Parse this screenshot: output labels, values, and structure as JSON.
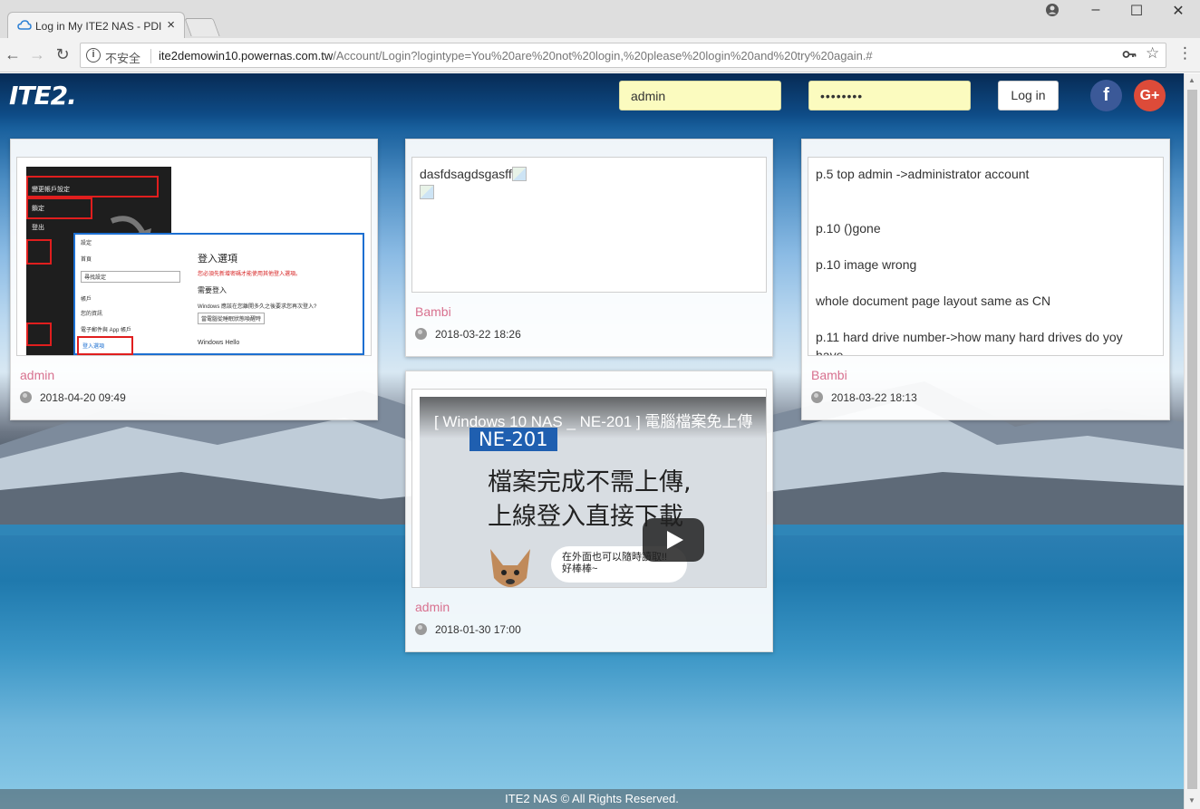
{
  "browser": {
    "tab_title": "Log in My ITE2 NAS - PDI",
    "tab_close": "×",
    "security_label": "不安全",
    "url_host": "ite2demowin10.powernas.com.tw",
    "url_path": "/Account/Login?logintype=You%20are%20not%20login,%20please%20login%20and%20try%20again.#"
  },
  "header": {
    "logo": "ITE2.",
    "username_value": "admin",
    "password_value": "••••••••",
    "login_button": "Log in",
    "facebook_label": "f",
    "google_label": "G+"
  },
  "cards": [
    {
      "author": "admin",
      "date": "2018-04-20 09:49",
      "mock": {
        "menu_1": "變更帳戶設定",
        "menu_2": "鎖定",
        "menu_3": "登出",
        "dialog_title": "登入選項",
        "dialog_warning": "您必須先新增密碼才能使用其他登入選項。",
        "dialog_sub": "需要登入",
        "line_1": "Windows 應該在您離開多久之後要求您再次登入?",
        "line_2": "當電腦從睡眠狀態喚醒時",
        "nav_1": "首頁",
        "nav_2": "尋找設定",
        "nav_3": "帳戶",
        "nav_4": "您的資訊",
        "nav_5": "電子郵件與 App 帳戶",
        "nav_6": "登入選項",
        "hello": "Windows Hello"
      }
    },
    {
      "author": "Bambi",
      "date": "2018-03-22 18:26",
      "text": "dasfdsagdsgasff"
    },
    {
      "author": "Bambi",
      "date": "2018-03-22 18:13",
      "notes": [
        "p.5 top admin ->administrator account",
        "p.10 ()gone",
        "p.10 image wrong",
        "whole document page layout same as CN",
        "p.11 hard drive number->how many hard drives do yoy",
        "have"
      ]
    },
    {
      "author": "admin",
      "date": "2018-01-30 17:00",
      "video": {
        "title": "[ Windows 10 NAS _ NE-201 ] 電腦檔案免上傳",
        "tag": "NE-201",
        "line_1": "檔案完成不需上傳,",
        "line_2": "上線登入直接下載",
        "bubble": "在外面也可以隨時讀取!! 好棒棒~"
      }
    }
  ],
  "footer": "ITE2 NAS © All Rights Reserved."
}
